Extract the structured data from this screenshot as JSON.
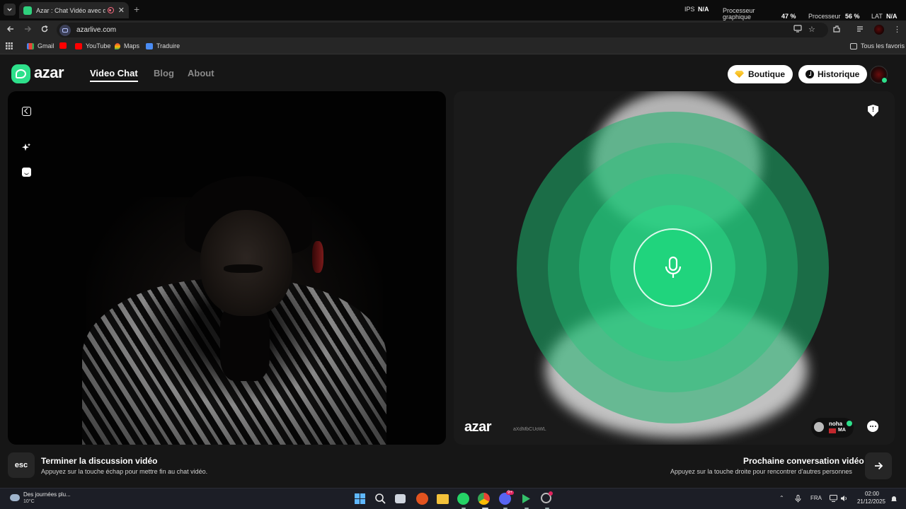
{
  "browser": {
    "tab_title": "Azar : Chat Vidéo avec de n",
    "url": "azarlive.com",
    "hwmon": {
      "ips_label": "IPS",
      "ips_value": "N/A",
      "gpu_label_line1": "Processeur",
      "gpu_label_line2": "graphique",
      "gpu_value": "47 %",
      "cpu_label": "Processeur",
      "cpu_value": "56 %",
      "lat_label": "LAT",
      "lat_value": "N/A"
    },
    "bookmarks": [
      {
        "label": "Gmail",
        "icon": "gmail-icon"
      },
      {
        "label": "YouTube",
        "icon": "youtube-icon"
      },
      {
        "label": "Maps",
        "icon": "maps-icon"
      },
      {
        "label": "Traduire",
        "icon": "translate-icon"
      }
    ],
    "all_bookmarks_label": "Tous les favoris"
  },
  "site": {
    "logo_text": "azar",
    "nav": {
      "video_chat": "Video Chat",
      "blog": "Blog",
      "about": "About"
    },
    "buttons": {
      "boutique": "Boutique",
      "historique": "Historique"
    },
    "partner": {
      "watermark_logo": "azar",
      "watermark_code": "aXdMbCUoWL",
      "name": "noha",
      "country_code": "MA"
    },
    "hints": {
      "end": {
        "key": "esc",
        "title": "Terminer la discussion vidéo",
        "subtitle": "Appuyez sur la touche échap pour mettre fin au chat vidéo."
      },
      "next": {
        "title": "Prochaine conversation vidéo",
        "subtitle": "Appuyez sur la touche droite pour rencontrer d'autres personnes"
      }
    },
    "colors": {
      "accent": "#2ee08b",
      "mic_button": "#20d47d",
      "background": "#161616"
    }
  },
  "taskbar": {
    "weather_text": "Des journées plu...",
    "weather_temp": "10°C",
    "discord_badge": "9+",
    "language": "FRA",
    "time": "02:00",
    "date": "21/12/2025"
  }
}
